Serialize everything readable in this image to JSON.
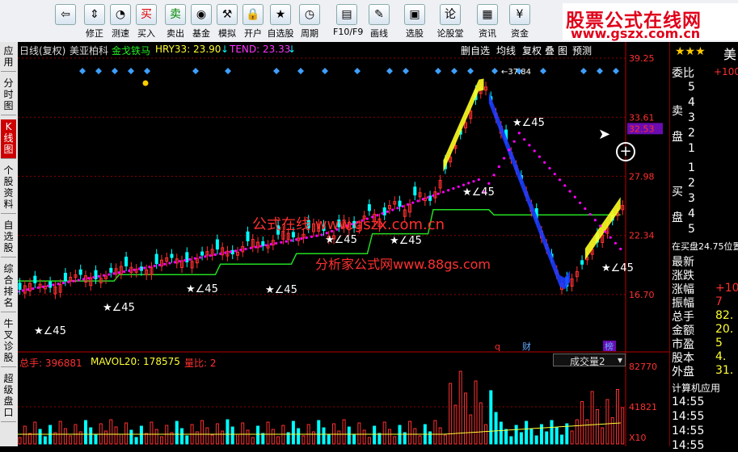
{
  "toolbar": {
    "buttons": [
      {
        "label": "",
        "icon": "back-arrow-icon"
      },
      {
        "label": "修正",
        "icon": "up-down-arrow-icon"
      },
      {
        "label": "测速",
        "icon": "speedometer-icon"
      },
      {
        "label": "买入",
        "icon": "buy-icon",
        "glyph": "买"
      },
      {
        "label": "卖出",
        "icon": "sell-icon",
        "glyph": "卖"
      },
      {
        "label": "基金",
        "icon": "fund-icon"
      },
      {
        "label": "模拟",
        "icon": "gavel-icon"
      },
      {
        "label": "开户",
        "icon": "lock-icon"
      },
      {
        "label": "自选股",
        "icon": "star-icon"
      },
      {
        "label": "周期",
        "icon": "clock-icon"
      },
      {
        "label": "F10/F9",
        "icon": "document-icon"
      },
      {
        "label": "画线",
        "icon": "pen-icon"
      },
      {
        "label": "选股",
        "icon": "select-stock-icon"
      },
      {
        "label": "论股堂",
        "icon": "forum-icon",
        "glyph": "论"
      },
      {
        "label": "资讯",
        "icon": "news-icon"
      },
      {
        "label": "资金",
        "icon": "money-icon"
      }
    ],
    "watermark_line1": "股票公式在线网",
    "watermark_line2": "www.gszx.com.cn"
  },
  "side_tabs": [
    {
      "label": "应用",
      "active": false
    },
    {
      "label": "分时图",
      "active": false
    },
    {
      "label": "K线图",
      "active": true
    },
    {
      "label": "个股资料",
      "active": false
    },
    {
      "label": "自选股",
      "active": false
    },
    {
      "label": "综合排名",
      "active": false
    },
    {
      "label": "牛叉诊股",
      "active": false
    },
    {
      "label": "超级盘口",
      "active": false
    }
  ],
  "kline_header": {
    "period": "日线(复权)",
    "stock_name": "美亚柏科",
    "indicator": "金戈铁马",
    "hry": "HRY33: 23.90",
    "tend": "TEND: 23.33",
    "menu_items": [
      "删自选",
      "均线",
      "复权",
      "叠",
      "图",
      "预测"
    ]
  },
  "price_axis": [
    "39.25",
    "33.61",
    "32.53",
    "27.98",
    "22.34",
    "16.70"
  ],
  "annotations": {
    "peak_label": "37.84",
    "signal_label": "∠45",
    "overlay1": "公式在线  www.gszx.com.cn",
    "overlay2": "分析家公式网www.88gs.com",
    "markers": [
      "q",
      "财",
      "榜"
    ]
  },
  "volume_header": {
    "total": "总手: 396881",
    "mavol": "MAVOL20: 178575",
    "ratio": "量比: 2",
    "dropdown": "成交量2"
  },
  "volume_axis": [
    "82770",
    "41821",
    "X10"
  ],
  "right_panel": {
    "header": "美",
    "weibi": "委比",
    "weibi_val": "+100",
    "sell_label": "卖盘",
    "buy_label": "买盘",
    "sell_levels": [
      "5",
      "4",
      "3",
      "2",
      "1"
    ],
    "buy_levels": [
      "1",
      "2",
      "3",
      "4",
      "5"
    ],
    "zaimai": "在买盘24.75位置",
    "quotes": [
      {
        "label": "最新",
        "value": ""
      },
      {
        "label": "涨跌",
        "value": ""
      },
      {
        "label": "涨幅",
        "value": "+10"
      },
      {
        "label": "振幅",
        "value": "7"
      },
      {
        "label": "总手",
        "value": "82."
      },
      {
        "label": "金额",
        "value": "20."
      },
      {
        "label": "市盈",
        "value": "5"
      },
      {
        "label": "股本",
        "value": "4."
      },
      {
        "label": "外盘",
        "value": "31."
      }
    ],
    "calc_app": "计算机应用",
    "times": [
      "14:55",
      "14:55",
      "14:55",
      "14:55"
    ]
  },
  "colors": {
    "bg": "#000000",
    "up": "#ff3030",
    "down": "#00ffff",
    "dots": "#ff00ff",
    "stop_line": "#22dd22",
    "bull_band": "#ffff22",
    "bear_band": "#1c3cff",
    "grid": "#8b0000",
    "diamond": "#3fa0ff"
  }
}
